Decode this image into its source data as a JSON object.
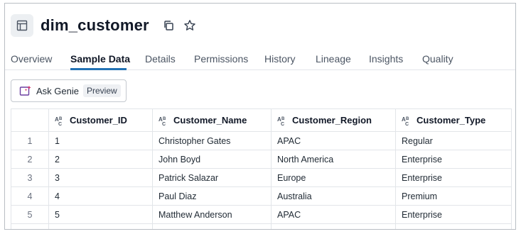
{
  "header": {
    "title": "dim_customer",
    "table_icon": "table-icon",
    "copy_icon": "copy-icon",
    "star_icon": "star-icon"
  },
  "tabs": [
    {
      "label": "Overview",
      "active": false
    },
    {
      "label": "Sample Data",
      "active": true
    },
    {
      "label": "Details",
      "active": false
    },
    {
      "label": "Permissions",
      "active": false
    },
    {
      "label": "History",
      "active": false
    },
    {
      "label": "Lineage",
      "active": false
    },
    {
      "label": "Insights",
      "active": false
    },
    {
      "label": "Quality",
      "active": false
    }
  ],
  "genie_button": {
    "label": "Ask Genie",
    "badge": "Preview",
    "icon": "genie-sparkle-icon"
  },
  "table": {
    "column_type_icon": "string-type-icon",
    "columns": [
      "Customer_ID",
      "Customer_Name",
      "Customer_Region",
      "Customer_Type"
    ],
    "rows": [
      {
        "num": "1",
        "cells": [
          "1",
          "Christopher Gates",
          "APAC",
          "Regular"
        ]
      },
      {
        "num": "2",
        "cells": [
          "2",
          "John Boyd",
          "North America",
          "Enterprise"
        ]
      },
      {
        "num": "3",
        "cells": [
          "3",
          "Patrick Salazar",
          "Europe",
          "Enterprise"
        ]
      },
      {
        "num": "4",
        "cells": [
          "4",
          "Paul Diaz",
          "Australia",
          "Premium"
        ]
      },
      {
        "num": "5",
        "cells": [
          "5",
          "Matthew Anderson",
          "APAC",
          "Enterprise"
        ]
      }
    ]
  },
  "colors": {
    "accent": "#2272b4",
    "genie_icon": "#d6336c"
  }
}
